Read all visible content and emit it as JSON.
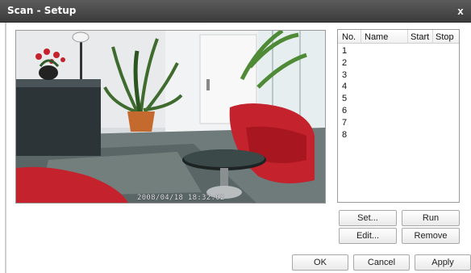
{
  "window": {
    "title": "Scan - Setup",
    "close_label": "x"
  },
  "preview": {
    "timestamp": "2008/04/18 18:32:02"
  },
  "table": {
    "headers": [
      "No.",
      "Name",
      "Start",
      "Stop"
    ],
    "rows": [
      "1",
      "2",
      "3",
      "4",
      "5",
      "6",
      "7",
      "8"
    ]
  },
  "buttons": {
    "set": "Set...",
    "run": "Run",
    "edit": "Edit...",
    "remove": "Remove",
    "ok": "OK",
    "cancel": "Cancel",
    "apply": "Apply"
  },
  "colors": {
    "titlebar": "#4a4a4a",
    "chair": "#c4222c"
  }
}
